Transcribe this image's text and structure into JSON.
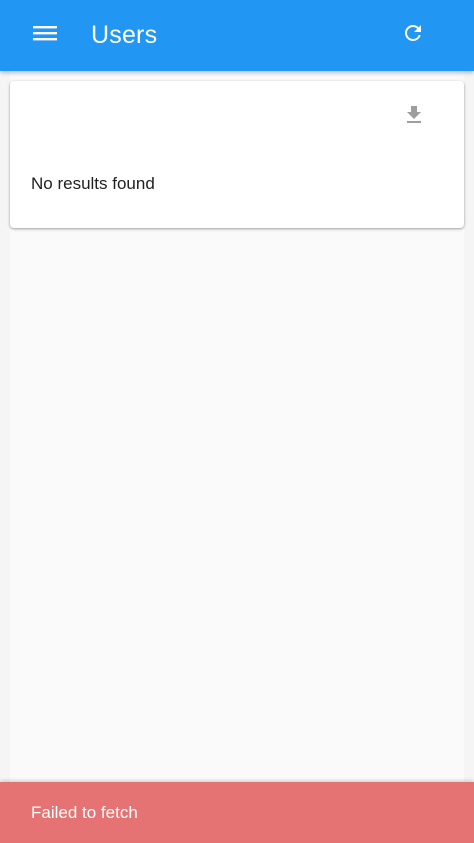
{
  "app_bar": {
    "title": "Users",
    "menu_icon": "menu-icon",
    "refresh_icon": "refresh-icon",
    "background_color": "#2196f3"
  },
  "card": {
    "download_icon": "download-icon",
    "empty_message": "No results found"
  },
  "snackbar": {
    "message": "Failed to fetch",
    "background_color": "#e57373"
  }
}
